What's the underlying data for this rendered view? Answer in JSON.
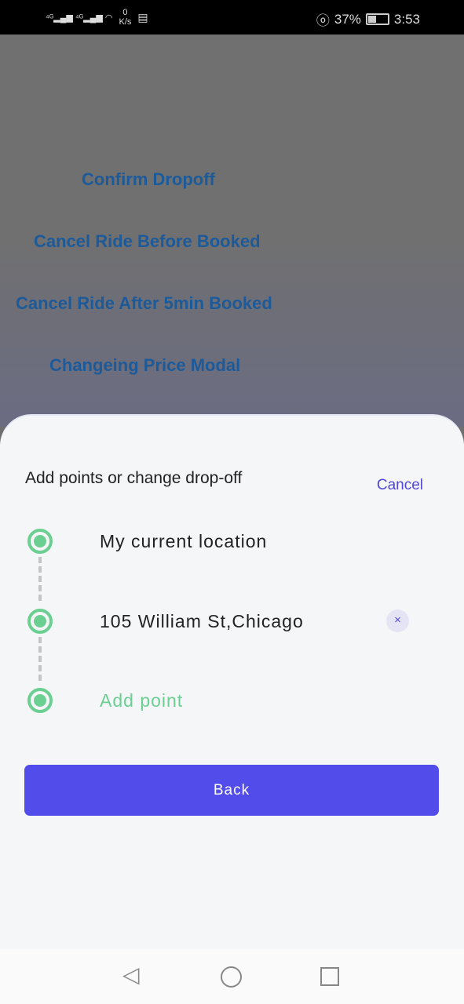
{
  "status_bar": {
    "network": "4G",
    "speed_value": "0",
    "speed_unit": "K/s",
    "battery": "37%",
    "time": "3:53"
  },
  "background_links": [
    "Confirm Dropoff",
    "Cancel Ride Before Booked",
    "Cancel Ride After 5min Booked",
    "Changeing Price Modal"
  ],
  "sheet": {
    "title": "Add points or change drop-off",
    "cancel": "Cancel",
    "stops": [
      "My current location",
      "105 William St,Chicago"
    ],
    "add_point": "Add point",
    "remove": "×",
    "back": "Back"
  },
  "colors": {
    "accent": "#524ceb",
    "green": "#6ccf92"
  }
}
